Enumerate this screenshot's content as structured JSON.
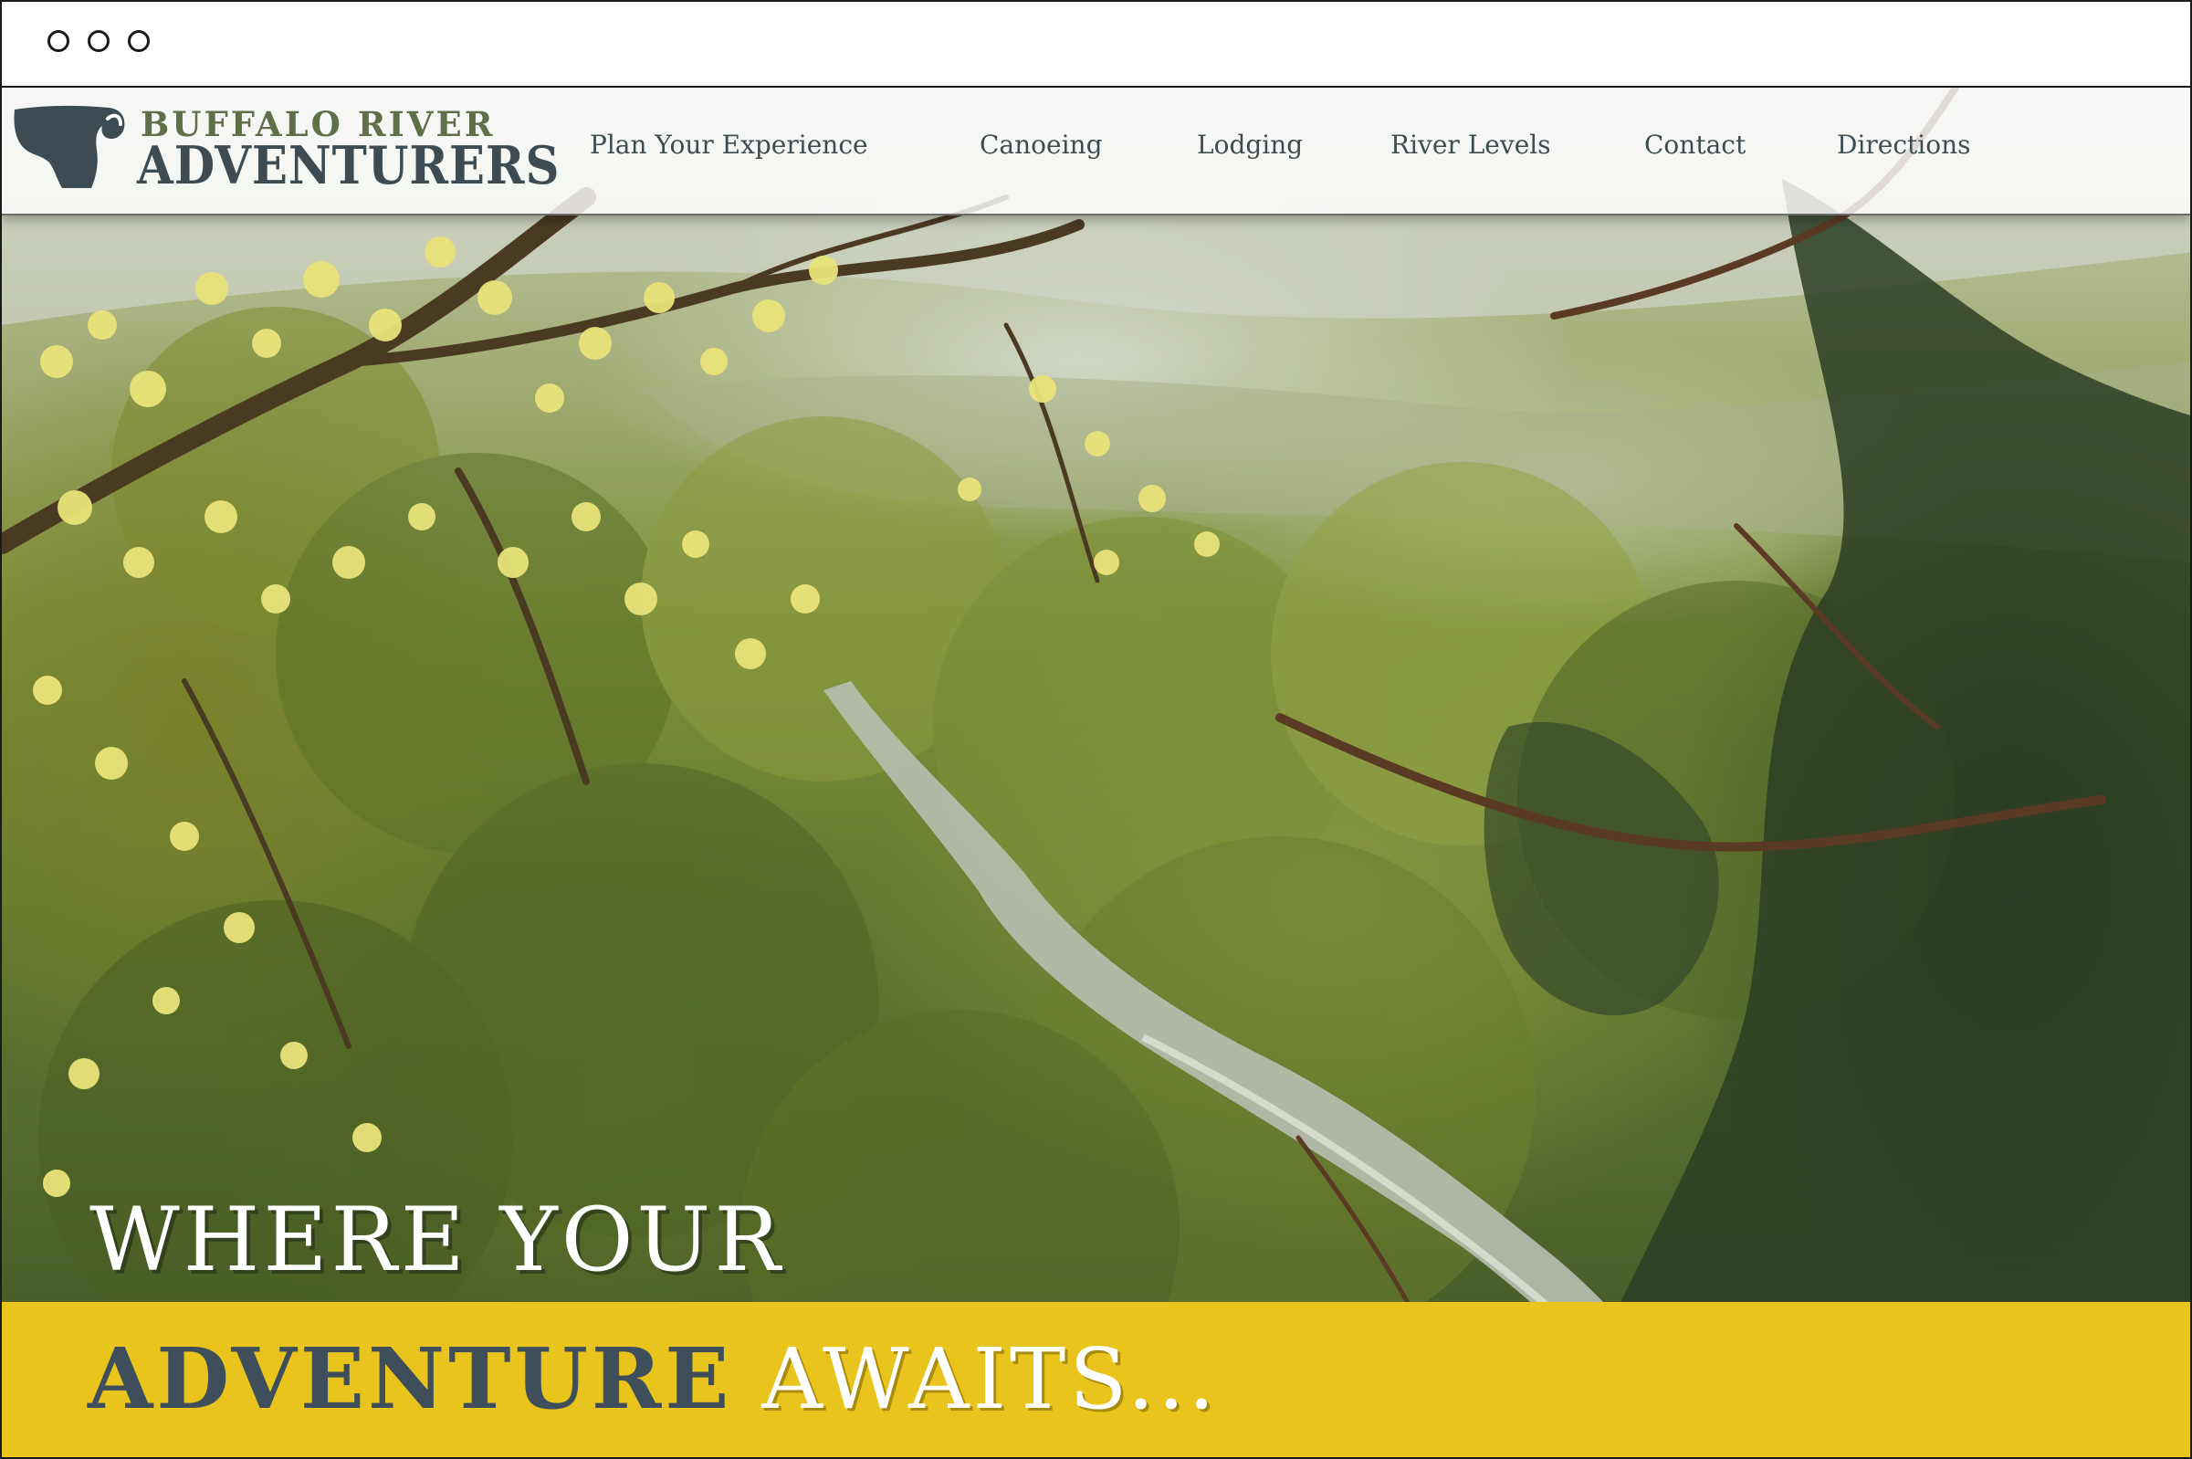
{
  "browser": {
    "window_controls": [
      "close",
      "minimize",
      "maximize"
    ]
  },
  "site": {
    "logo_icon": "buffalo-head-icon",
    "logo_line1": "BUFFALO RIVER",
    "logo_line2": "ADVENTURERS"
  },
  "nav": {
    "items": [
      {
        "label": "Plan Your Experience"
      },
      {
        "label": "Canoeing"
      },
      {
        "label": "Lodging"
      },
      {
        "label": "River Levels"
      },
      {
        "label": "Contact"
      },
      {
        "label": "Directions"
      }
    ]
  },
  "hero": {
    "headline_line1": "WHERE YOUR",
    "headline_strong": "ADVENTURE",
    "headline_light": "AWAITS..."
  },
  "colors": {
    "accent_yellow": "#e8c41c",
    "brand_slate": "#3e4f5b",
    "brand_green": "#5f6f4a",
    "nav_text": "#3e4d52"
  }
}
